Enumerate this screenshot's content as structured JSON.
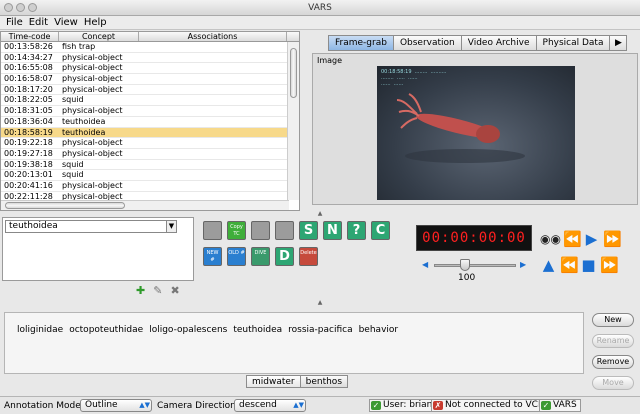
{
  "window": {
    "title": "VARS"
  },
  "menu": [
    "File",
    "Edit",
    "View",
    "Help"
  ],
  "table": {
    "headers": [
      "Time-code",
      "Concept",
      "Associations"
    ],
    "rows": [
      [
        "00:13:58:26",
        "fish trap",
        ""
      ],
      [
        "00:14:34:27",
        "physical-object",
        ""
      ],
      [
        "00:16:55:08",
        "physical-object",
        ""
      ],
      [
        "00:16:58:07",
        "physical-object",
        ""
      ],
      [
        "00:18:17:20",
        "physical-object",
        ""
      ],
      [
        "00:18:22:05",
        "squid",
        ""
      ],
      [
        "00:18:31:05",
        "physical-object",
        ""
      ],
      [
        "00:18:36:04",
        "teuthoidea",
        ""
      ],
      [
        "00:18:58:19",
        "teuthoidea",
        ""
      ],
      [
        "00:19:22:18",
        "physical-object",
        ""
      ],
      [
        "00:19:27:18",
        "physical-object",
        ""
      ],
      [
        "00:19:38:18",
        "squid",
        ""
      ],
      [
        "00:20:13:01",
        "squid",
        ""
      ],
      [
        "00:20:41:16",
        "physical-object",
        ""
      ],
      [
        "00:22:11:28",
        "physical-object",
        ""
      ]
    ],
    "selected_index": 8
  },
  "tabs": [
    "Frame-grab",
    "Observation",
    "Video Archive",
    "Physical Data"
  ],
  "active_tab": 0,
  "image_legend": "Image",
  "image_overlay_text": "00:18:58:19  ........  ..........\n........  .....  ......\n......  ......",
  "concept_combo": {
    "value": "teuthoidea"
  },
  "tool_buttons": [
    "Copy TC",
    "NEW #",
    "OLD #",
    "DIVE",
    "Delete",
    "S",
    "N",
    "?",
    "C",
    "D"
  ],
  "vcr": {
    "timecode": "00:00:00:00",
    "speed": "100"
  },
  "associations": [
    "loliginidae",
    "octopoteuthidae",
    "loligo-opalescens",
    "teuthoidea",
    "rossia-pacifica",
    "behavior"
  ],
  "assoc_tabs": [
    "midwater",
    "benthos"
  ],
  "side_buttons": [
    "New",
    "Rename",
    "Remove",
    "Move"
  ],
  "status": {
    "annotation_mode_label": "Annotation Mode:",
    "annotation_mode": "Outline",
    "camera_direction_label": "Camera Direction:",
    "camera_direction": "descend",
    "user": "User: brian",
    "vcr_status": "Not connected to VCR",
    "app": "VARS"
  }
}
